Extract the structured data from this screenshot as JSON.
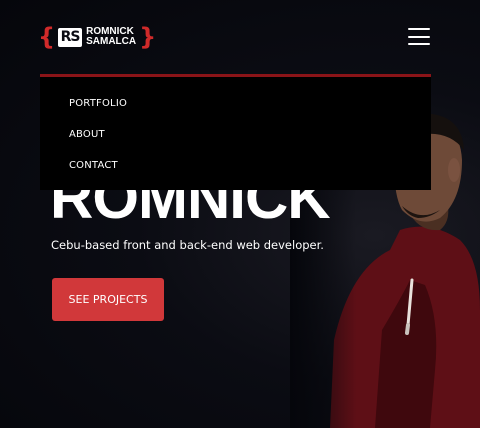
{
  "header": {
    "logo_mark": "RS",
    "logo_line1": "ROMNICK",
    "logo_line2": "SAMALCA",
    "logo_brace_open": "{",
    "logo_brace_close": "}"
  },
  "menu": {
    "items": [
      {
        "label": "PORTFOLIO"
      },
      {
        "label": "ABOUT"
      },
      {
        "label": "CONTACT"
      }
    ]
  },
  "hero": {
    "title": "ROMNICK",
    "subtitle": "Cebu-based front and back-end web developer.",
    "cta_label": "SEE PROJECTS"
  },
  "colors": {
    "accent": "#d1383a",
    "menu_border": "#8b1418",
    "background": "#06070d"
  },
  "icons": {
    "menu": "hamburger-menu-icon"
  }
}
